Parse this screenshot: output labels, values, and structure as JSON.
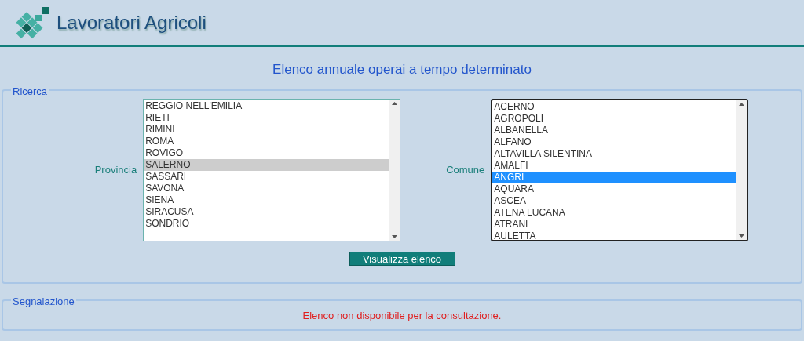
{
  "header": {
    "title": "Lavoratori Agricoli"
  },
  "page_title": "Elenco annuale operai a tempo determinato",
  "search": {
    "legend": "Ricerca",
    "provincia": {
      "label": "Provincia",
      "items": [
        {
          "label": "REGGIO NELL'EMILIA",
          "selected": false
        },
        {
          "label": "RIETI",
          "selected": false
        },
        {
          "label": "RIMINI",
          "selected": false
        },
        {
          "label": "ROMA",
          "selected": false
        },
        {
          "label": "ROVIGO",
          "selected": false
        },
        {
          "label": "SALERNO",
          "selected": true
        },
        {
          "label": "SASSARI",
          "selected": false
        },
        {
          "label": "SAVONA",
          "selected": false
        },
        {
          "label": "SIENA",
          "selected": false
        },
        {
          "label": "SIRACUSA",
          "selected": false
        },
        {
          "label": "SONDRIO",
          "selected": false
        }
      ]
    },
    "comune": {
      "label": "Comune",
      "items": [
        {
          "label": "ACERNO",
          "selected": false
        },
        {
          "label": "AGROPOLI",
          "selected": false
        },
        {
          "label": "ALBANELLA",
          "selected": false
        },
        {
          "label": "ALFANO",
          "selected": false
        },
        {
          "label": "ALTAVILLA SILENTINA",
          "selected": false
        },
        {
          "label": "AMALFI",
          "selected": false
        },
        {
          "label": "ANGRI",
          "selected": true
        },
        {
          "label": "AQUARA",
          "selected": false
        },
        {
          "label": "ASCEA",
          "selected": false
        },
        {
          "label": "ATENA LUCANA",
          "selected": false
        },
        {
          "label": "ATRANI",
          "selected": false
        },
        {
          "label": "AULETTA",
          "selected": false
        }
      ]
    },
    "button": "Visualizza elenco"
  },
  "report": {
    "legend": "Segnalazione",
    "message": "Elenco non disponibile per la consultazione."
  }
}
